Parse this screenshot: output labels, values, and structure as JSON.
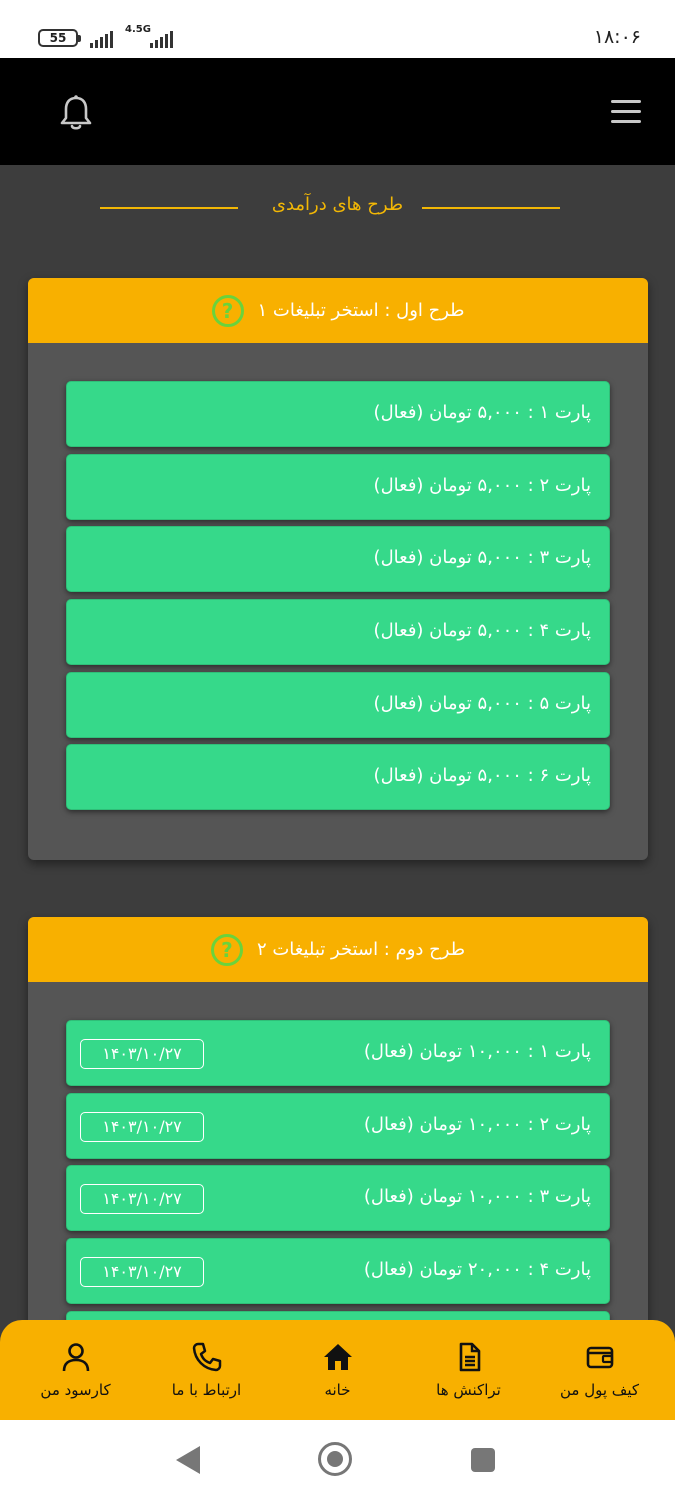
{
  "status_bar": {
    "time": "۱۸:۰۶",
    "battery": "55",
    "network": "4.5G"
  },
  "header": {
    "menu_icon": "hamburger-icon",
    "bell_icon": "bell-icon"
  },
  "section": {
    "title": "طرح های درآمدی"
  },
  "plans": [
    {
      "title": "طرح اول : استخر تبلیغات ۱",
      "help": "?",
      "parts": [
        {
          "label": "پارت ۱ : ۵,۰۰۰ تومان (فعال)"
        },
        {
          "label": "پارت ۲ : ۵,۰۰۰ تومان (فعال)"
        },
        {
          "label": "پارت ۳ : ۵,۰۰۰ تومان (فعال)"
        },
        {
          "label": "پارت ۴ : ۵,۰۰۰ تومان (فعال)"
        },
        {
          "label": "پارت ۵ : ۵,۰۰۰ تومان (فعال)"
        },
        {
          "label": "پارت ۶ : ۵,۰۰۰ تومان (فعال)"
        }
      ]
    },
    {
      "title": "طرح دوم : استخر تبلیغات ۲",
      "help": "?",
      "parts": [
        {
          "label": "پارت ۱ : ۱۰,۰۰۰ تومان (فعال)",
          "date": "۱۴۰۳/۱۰/۲۷"
        },
        {
          "label": "پارت ۲ : ۱۰,۰۰۰ تومان (فعال)",
          "date": "۱۴۰۳/۱۰/۲۷"
        },
        {
          "label": "پارت ۳ : ۱۰,۰۰۰ تومان (فعال)",
          "date": "۱۴۰۳/۱۰/۲۷"
        },
        {
          "label": "پارت ۴ : ۲۰,۰۰۰ تومان (فعال)",
          "date": "۱۴۰۳/۱۰/۲۷"
        }
      ]
    }
  ],
  "bottom_nav": [
    {
      "label": "کیف پول من",
      "icon": "wallet-icon"
    },
    {
      "label": "تراکنش ها",
      "icon": "document-icon"
    },
    {
      "label": "خانه",
      "icon": "home-icon"
    },
    {
      "label": "ارتباط با ما",
      "icon": "phone-icon"
    },
    {
      "label": "کارسود من",
      "icon": "user-icon"
    }
  ],
  "colors": {
    "accent": "#f8b000",
    "row": "#36d98a",
    "help": "#6ad33c",
    "background": "#3d3d3d"
  }
}
